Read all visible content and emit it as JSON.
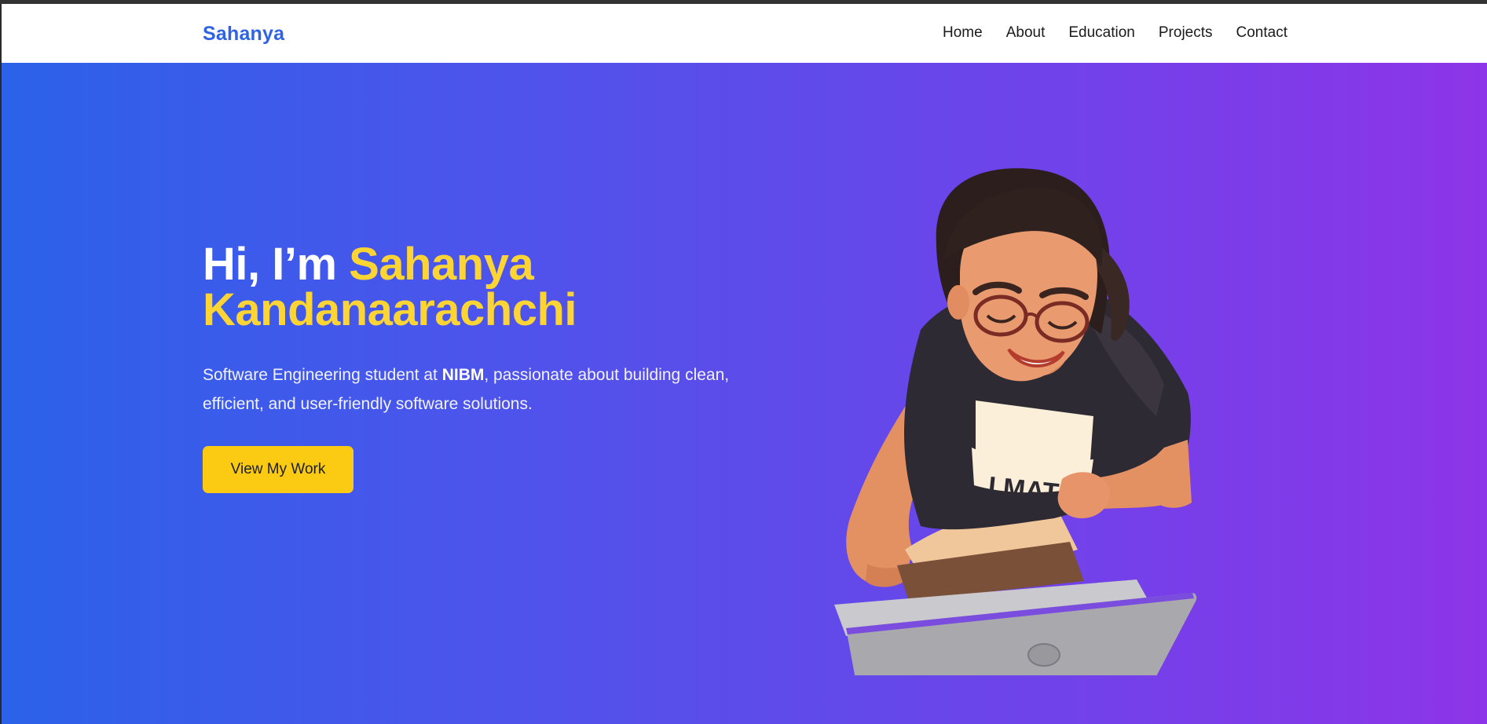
{
  "nav": {
    "brand": "Sahanya",
    "links": [
      "Home",
      "About",
      "Education",
      "Projects",
      "Contact"
    ]
  },
  "hero": {
    "greeting": "Hi, I’m ",
    "name_first": "Sahanya",
    "name_last": "Kandanaarachchi",
    "desc_pre": "Software Engineering student at ",
    "desc_bold": "NIBM",
    "desc_post": ", passionate about building clean, efficient, and user-friendly software solutions.",
    "cta_label": "View My Work",
    "shirt_text": "I MAT"
  },
  "colors": {
    "brand": "#2f63e4",
    "accent": "#fcd535",
    "button": "#fbcb14",
    "gradient_start": "#2b62ea",
    "gradient_end": "#8d35e8"
  }
}
